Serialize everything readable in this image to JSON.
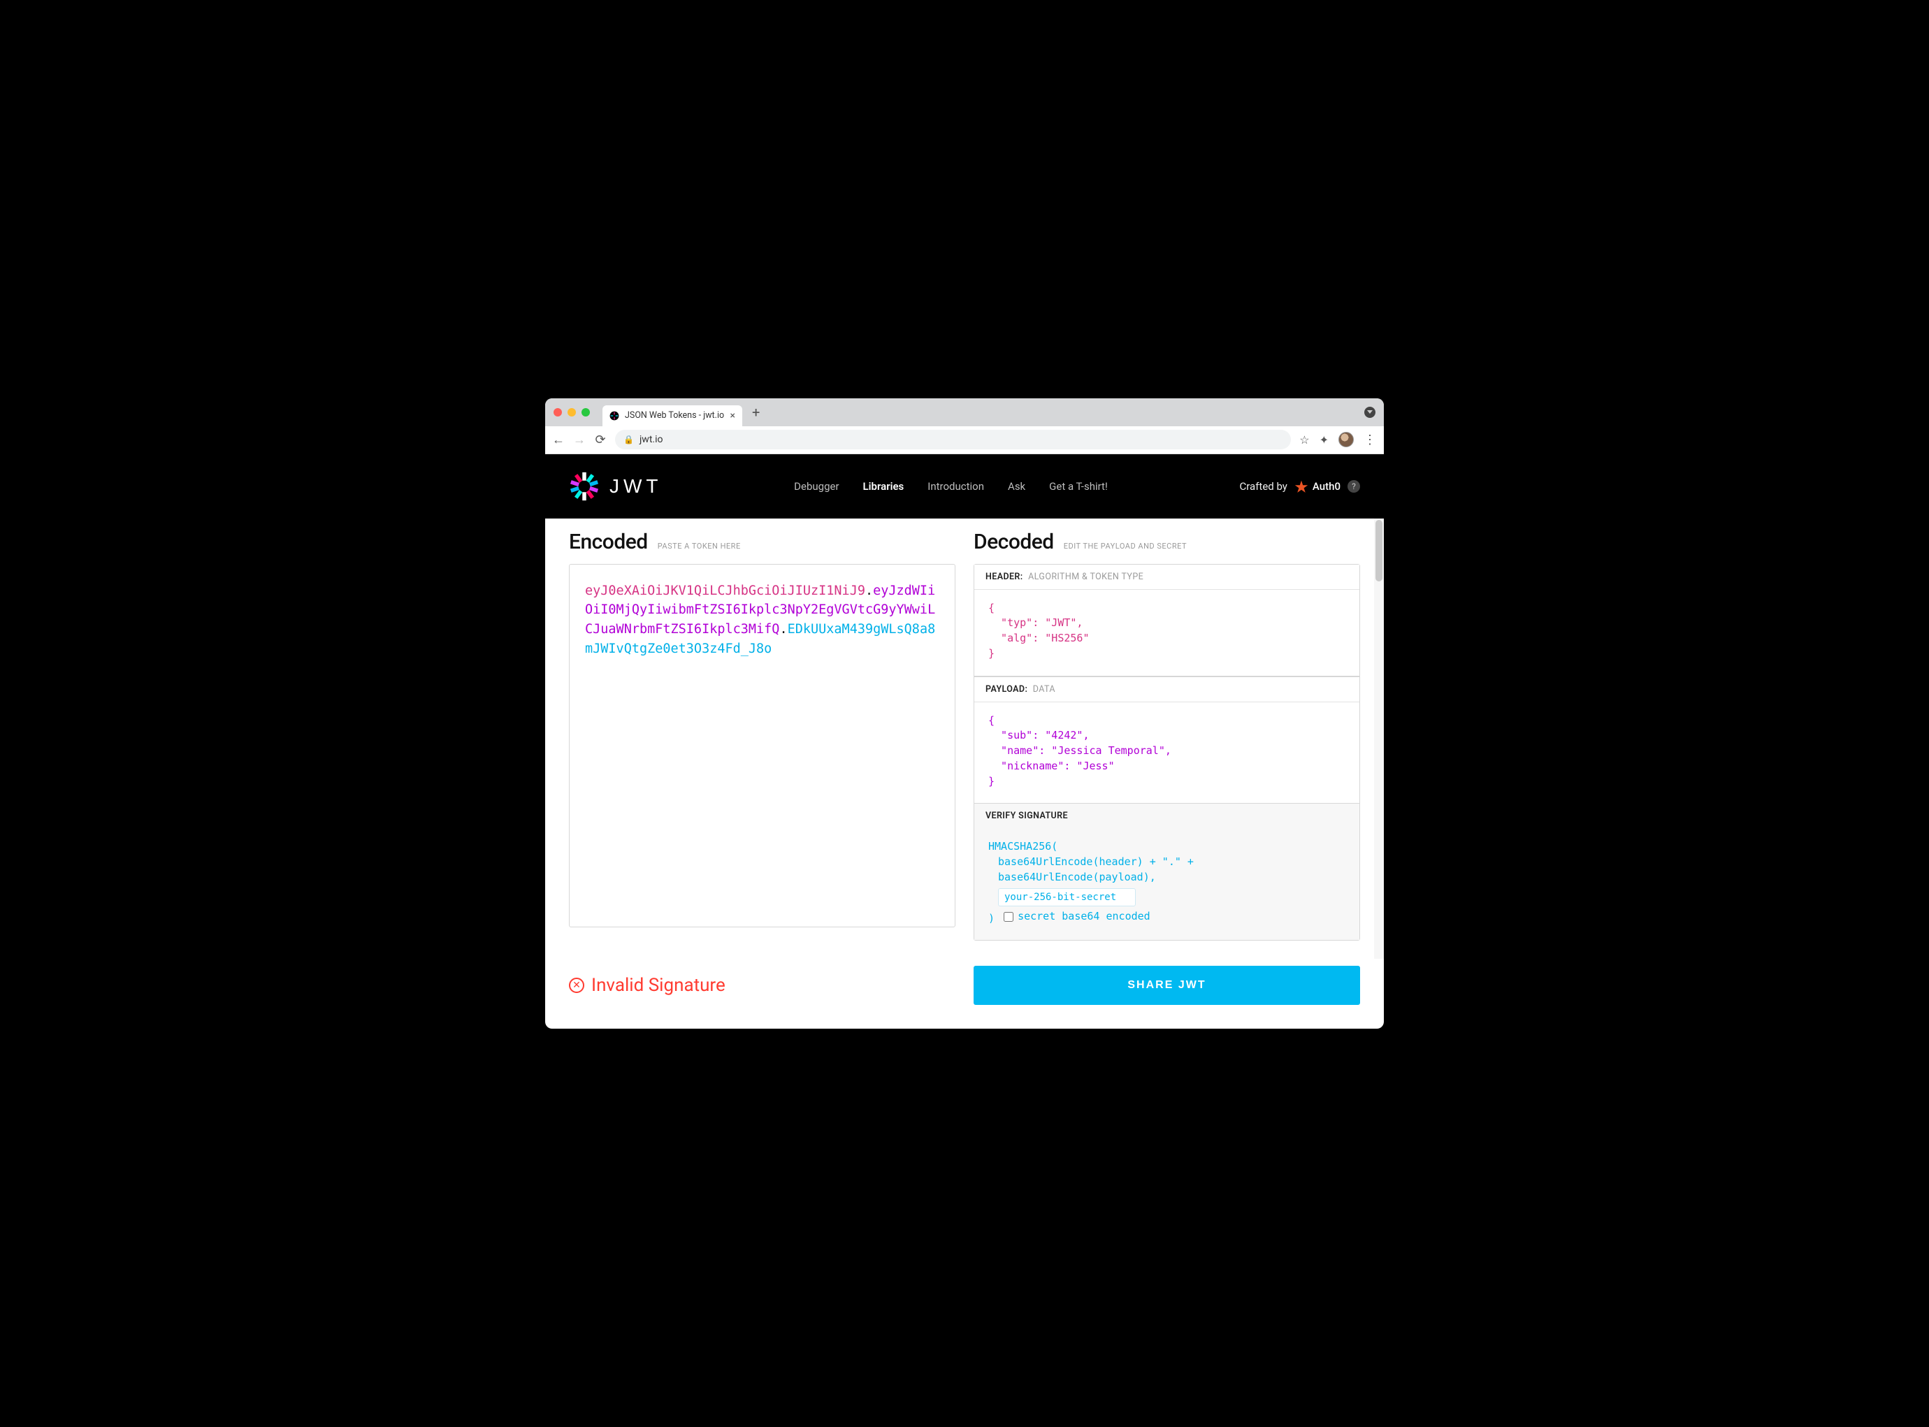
{
  "browser": {
    "tab_title": "JSON Web Tokens - jwt.io",
    "url_display": "jwt.io"
  },
  "header": {
    "brand_word": "J ∕∕ T",
    "nav": {
      "debugger": "Debugger",
      "libraries": "Libraries",
      "introduction": "Introduction",
      "ask": "Ask",
      "tshirt": "Get a T-shirt!"
    },
    "crafted_by_label": "Crafted by",
    "auth0_label": "Auth0"
  },
  "encoded": {
    "title": "Encoded",
    "subtitle": "PASTE A TOKEN HERE",
    "token_header": "eyJ0eXAiOiJKV1QiLCJhbGciOiJIUzI1NiJ9",
    "token_payload": "eyJzdWIiOiI0MjQyIiwibmFtZSI6Ikplc3NpY2EgVGVtcG9yYWwiLCJuaWNrbmFtZSI6Ikplc3MifQ",
    "token_signature": "EDkUUxaM439gWLsQ8a8mJWIvQtgZe0et3O3z4Fd_J8o"
  },
  "decoded": {
    "title": "Decoded",
    "subtitle": "EDIT THE PAYLOAD AND SECRET",
    "header_section": {
      "label": "HEADER:",
      "desc": "ALGORITHM & TOKEN TYPE"
    },
    "header_json": "{\n  \"typ\": \"JWT\",\n  \"alg\": \"HS256\"\n}",
    "payload_section": {
      "label": "PAYLOAD:",
      "desc": "DATA"
    },
    "payload_json": "{\n  \"sub\": \"4242\",\n  \"name\": \"Jessica Temporal\",\n  \"nickname\": \"Jess\"\n}",
    "verify_section": {
      "label": "VERIFY SIGNATURE"
    },
    "sig": {
      "fn": "HMACSHA256(",
      "line1": "base64UrlEncode(header) + \".\" +",
      "line2": "base64UrlEncode(payload),",
      "secret_value": "your-256-bit-secret",
      "close": ")",
      "checkbox_label": "secret base64 encoded"
    }
  },
  "footer": {
    "status_text": "Invalid Signature",
    "share_label": "SHARE JWT"
  }
}
